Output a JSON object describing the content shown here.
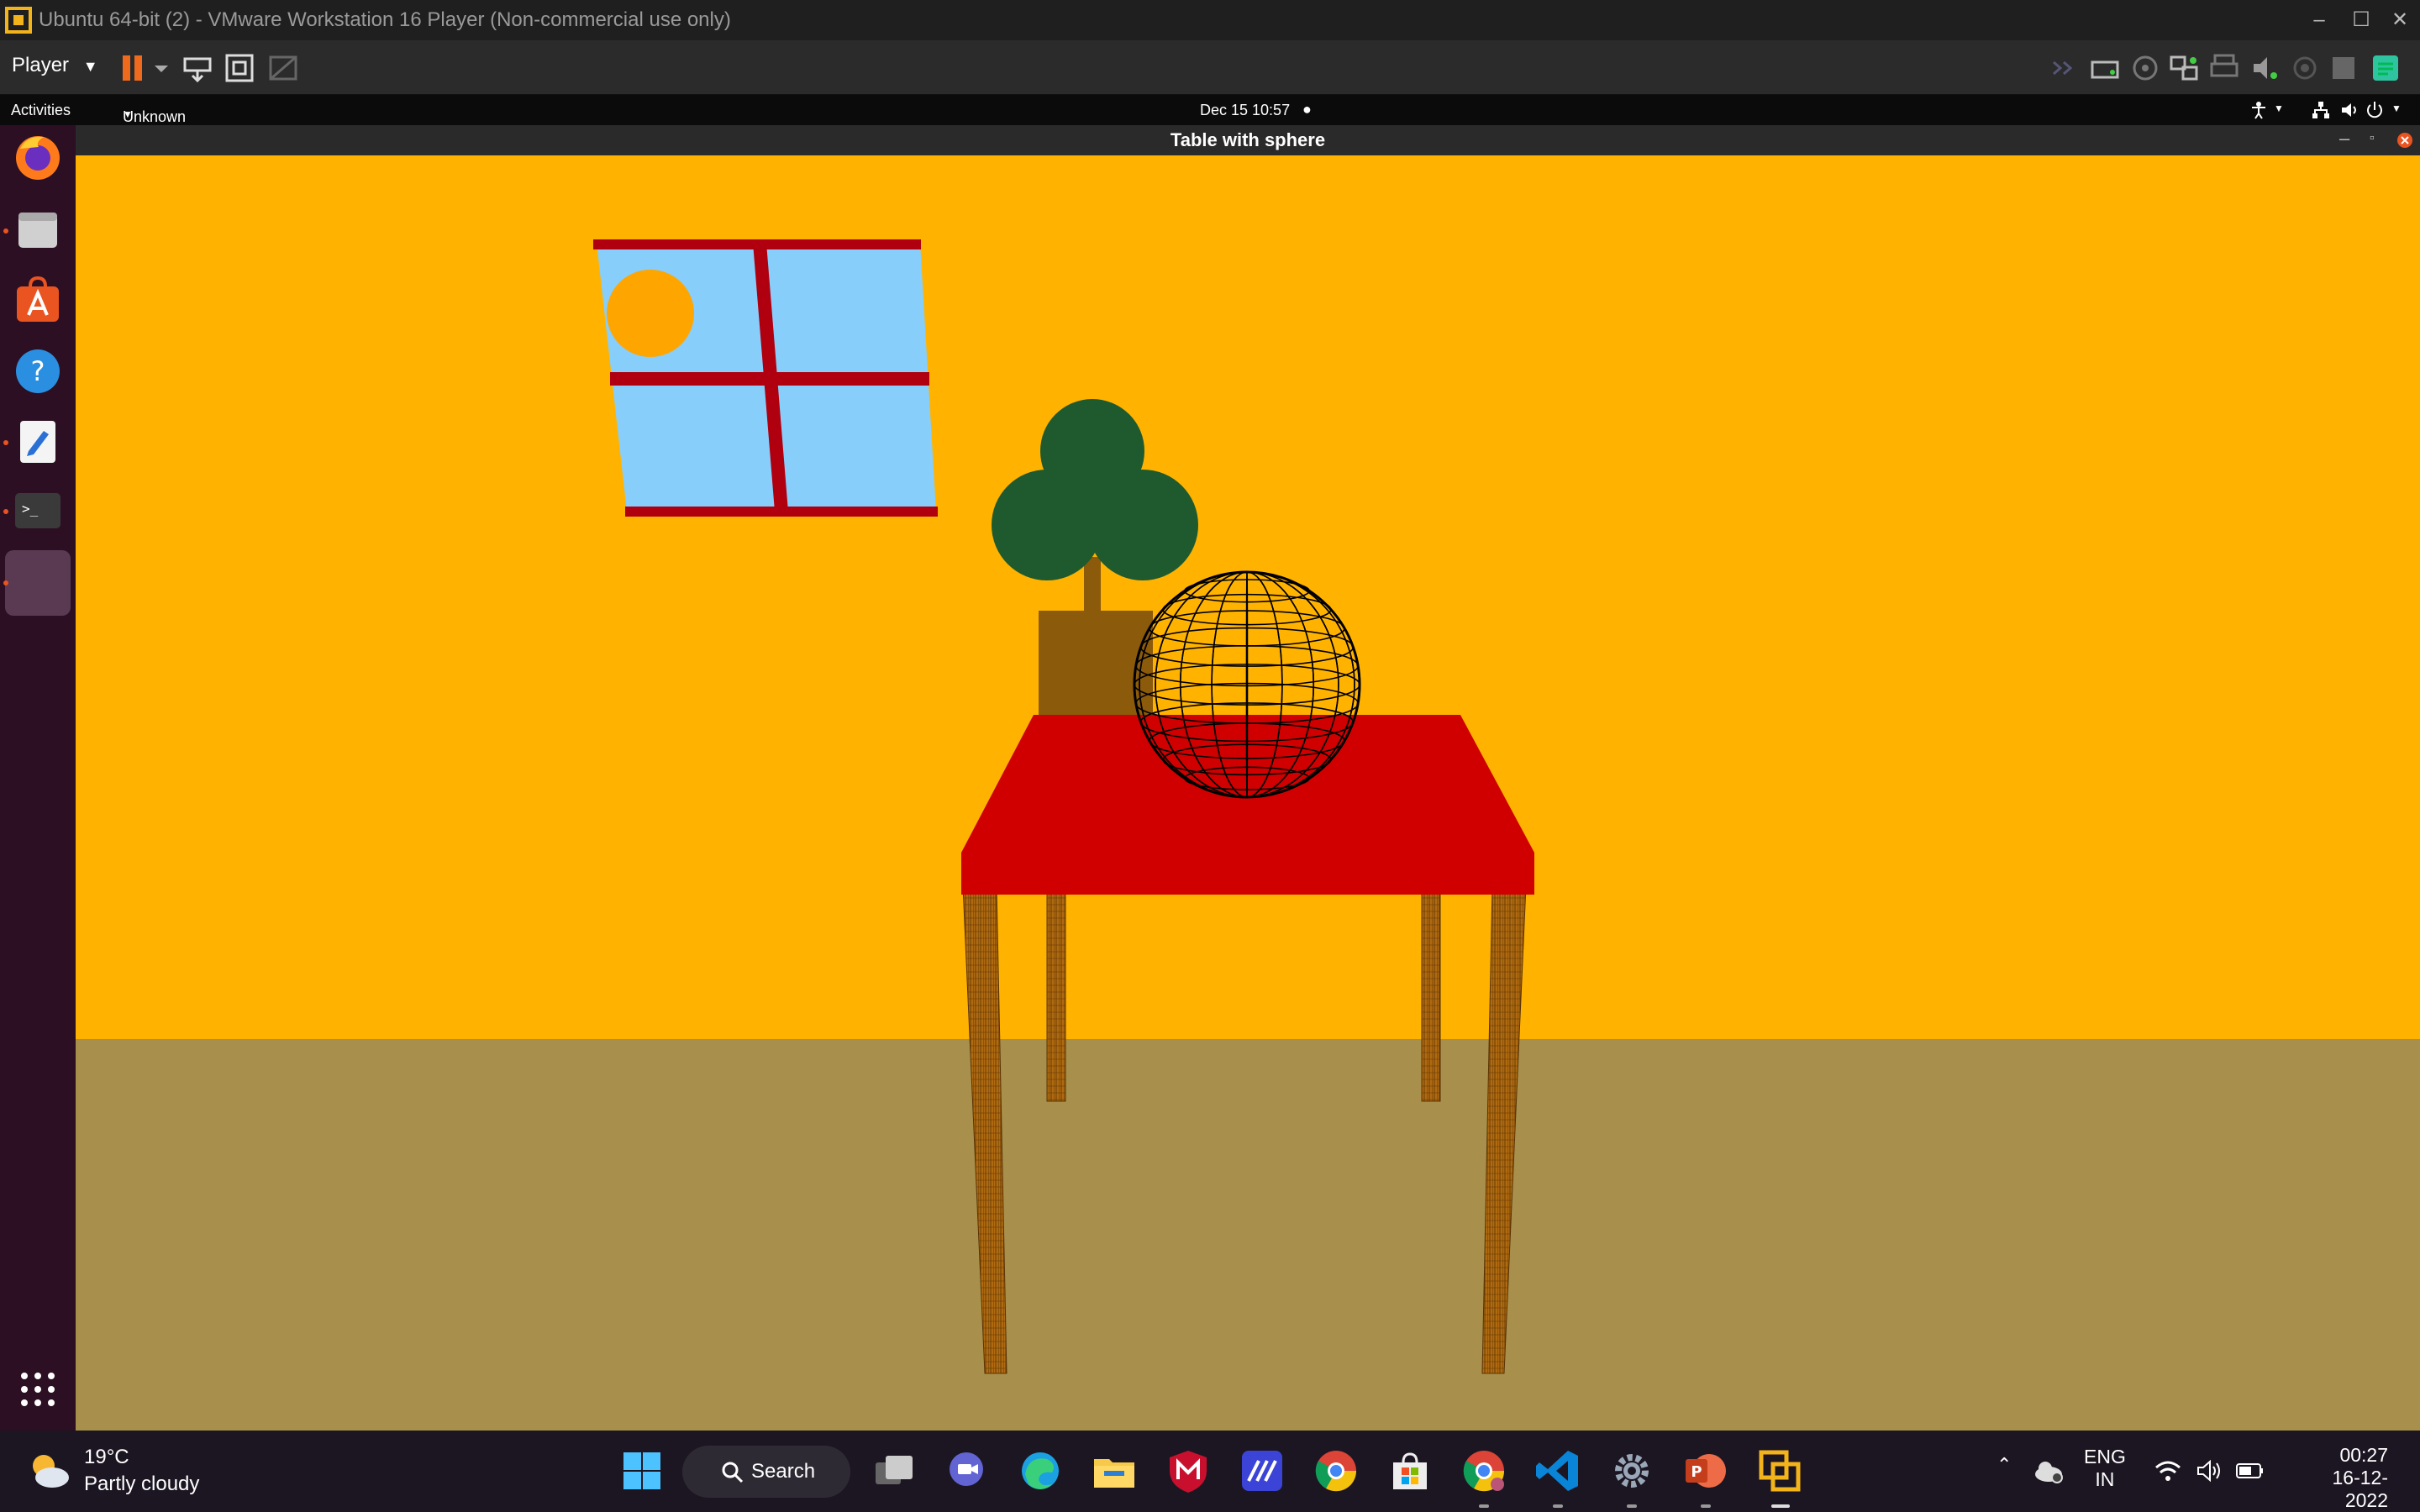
{
  "vmware": {
    "title": "Ubuntu 64-bit (2) - VMware Workstation 16 Player (Non-commercial use only)",
    "player_menu": "Player"
  },
  "ubuntu_bar": {
    "activities": "Activities",
    "app_menu": "Unknown",
    "clock": "Dec 15  10:57"
  },
  "app_window": {
    "title": "Table with sphere"
  },
  "scene_colors": {
    "wall": "#FFB300",
    "floor": "#A8904C",
    "table_top": "#D00000",
    "sky": "#87CEFA",
    "frame": "#B00010",
    "sun": "#FFA500",
    "leaves": "#1E5A2E",
    "pot": "#8B5A0A"
  },
  "taskbar": {
    "weather_temp": "19°C",
    "weather_desc": "Partly cloudy",
    "search_label": "Search",
    "lang_top": "ENG",
    "lang_bottom": "IN",
    "time": "00:27",
    "date": "16-12-2022"
  }
}
